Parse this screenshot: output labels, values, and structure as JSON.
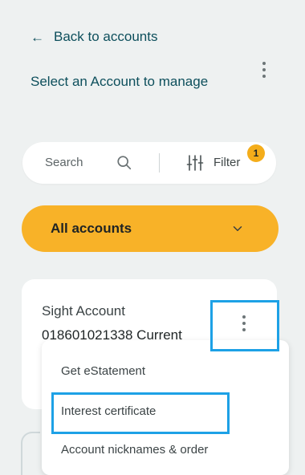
{
  "header": {
    "back_label": "Back to accounts",
    "subtitle": "Select an Account to manage"
  },
  "search": {
    "label": "Search",
    "filter_label": "Filter",
    "filter_count": "1"
  },
  "accounts_dropdown": {
    "selected": "All accounts"
  },
  "account_card": {
    "name": "Sight Account",
    "number": "018601021338 Current"
  },
  "context_menu": {
    "items": [
      "Get eStatement",
      "Interest certificate",
      "Account nicknames & order"
    ]
  },
  "colors": {
    "accent": "#f8b228",
    "primary_text": "#0d4f5c",
    "highlight_border": "#1da1e6"
  }
}
